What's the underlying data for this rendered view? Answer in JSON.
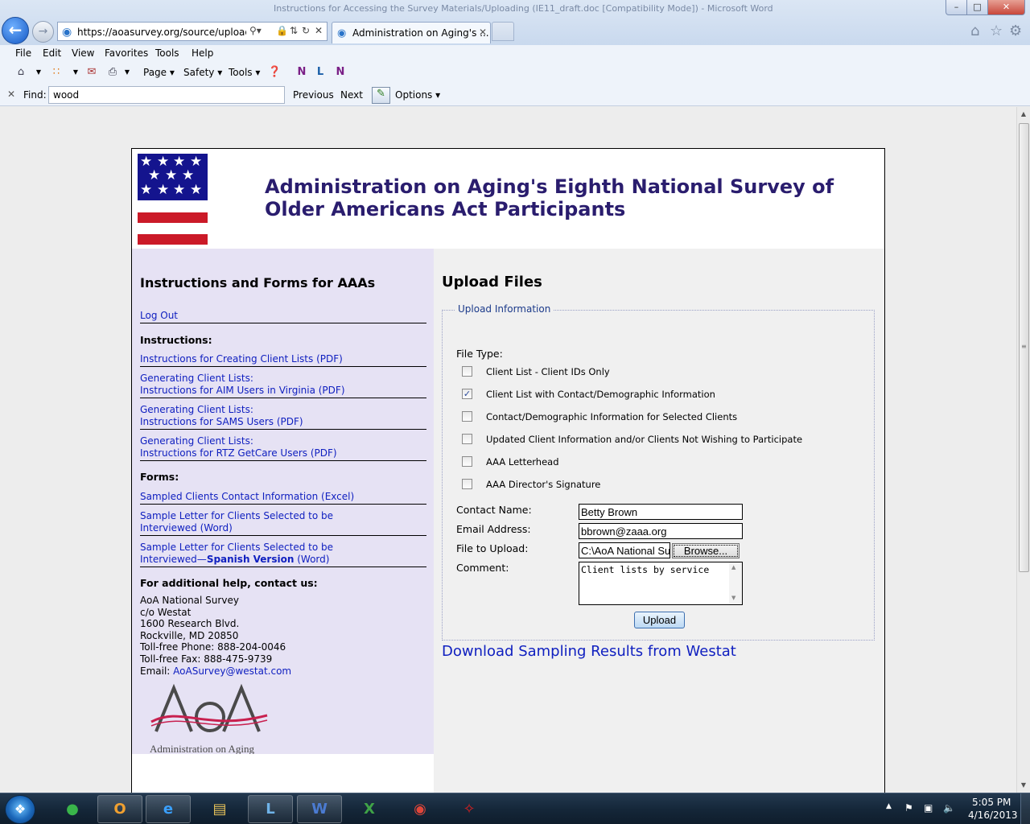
{
  "browser": {
    "window_title": "Instructions for Accessing the Survey Materials/Uploading (IE11_draft.doc [Compatibility Mode]) - Microsoft Word",
    "address": "https://aoasurvey.org/source/uploadda",
    "tab_title": "Administration on Aging's ...",
    "menu": [
      "File",
      "Edit",
      "View",
      "Favorites",
      "Tools",
      "Help"
    ],
    "commands": {
      "page": "Page",
      "safety": "Safety",
      "tools": "Tools"
    },
    "find": {
      "label": "Find:",
      "value": "wood",
      "previous": "Previous",
      "next": "Next",
      "options": "Options"
    }
  },
  "site": {
    "title": "Administration on Aging's Eighth National Survey of Older Americans Act Participants"
  },
  "sidebar": {
    "heading": "Instructions and Forms for AAAs",
    "logout": "Log Out",
    "instructions_heading": "Instructions:",
    "instructions": [
      {
        "line1": "Instructions for Creating Client Lists (PDF)",
        "line2": ""
      },
      {
        "line1": "Generating Client Lists:",
        "line2": "Instructions for AIM Users in Virginia (PDF)"
      },
      {
        "line1": "Generating Client Lists:",
        "line2": "Instructions for SAMS Users (PDF)"
      },
      {
        "line1": "Generating Client Lists:",
        "line2": "Instructions for RTZ GetCare Users (PDF)"
      }
    ],
    "forms_heading": "Forms:",
    "forms": [
      {
        "line1": "Sampled Clients Contact Information (Excel)",
        "line2": ""
      },
      {
        "line1": "Sample Letter for Clients Selected to be",
        "line2": "Interviewed (Word)"
      },
      {
        "line1": "Sample Letter for Clients Selected to be",
        "line2a": "Interviewed—",
        "line2b": "Spanish Version",
        "line2c": " (Word)"
      }
    ],
    "help_heading": "For additional help, contact us:",
    "contact": "AoA National Survey\nc/o Westat\n1600 Research Blvd.\nRockville, MD 20850\nToll-free Phone: 888-204-0046\nToll-free Fax: 888-475-9739\nEmail: ",
    "contact_email": "AoASurvey@westat.com",
    "logo_text": "AoA",
    "logo_caption": "Administration on Aging"
  },
  "upload": {
    "heading": "Upload Files",
    "legend": "Upload Information",
    "file_type_label": "File Type:",
    "file_types": [
      {
        "label": "Client List - Client IDs Only",
        "checked": false
      },
      {
        "label": "Client List with Contact/Demographic Information",
        "checked": true
      },
      {
        "label": "Contact/Demographic Information for Selected Clients",
        "checked": false
      },
      {
        "label": "Updated Client Information and/or Clients Not Wishing to Participate",
        "checked": false
      },
      {
        "label": "AAA Letterhead",
        "checked": false
      },
      {
        "label": "AAA Director's Signature",
        "checked": false
      }
    ],
    "contact_name_label": "Contact Name:",
    "contact_name": "Betty Brown",
    "email_label": "Email Address:",
    "email": "bbrown@zaaa.org",
    "file_label": "File to Upload:",
    "file_value": "C:\\AoA National Su",
    "browse": "Browse...",
    "comment_label": "Comment:",
    "comment": "Client lists by service",
    "upload_button": "Upload",
    "download_link": "Download Sampling Results from Westat"
  },
  "taskbar": {
    "time": "5:05 PM",
    "date": "4/16/2013"
  },
  "colors": {
    "title": "#2a1d6e",
    "link": "#1020c0",
    "sidebar_bg": "#e6e2f4",
    "flag_blue": "#14148e",
    "flag_red": "#cb1a28"
  }
}
